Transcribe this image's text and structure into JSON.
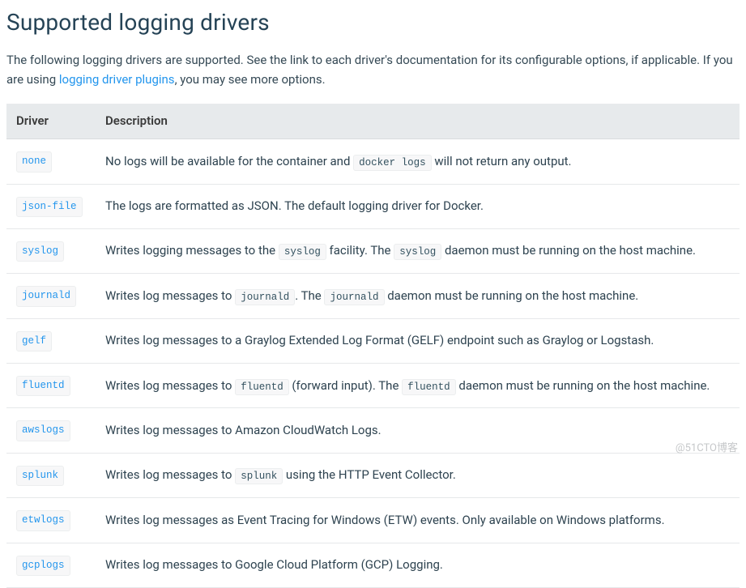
{
  "heading": "Supported logging drivers",
  "intro": {
    "part1": "The following logging drivers are supported. See the link to each driver's documentation for its configurable options, if applicable. If you are using ",
    "link": "logging driver plugins",
    "part2": ", you may see more options."
  },
  "table": {
    "headers": {
      "driver": "Driver",
      "description": "Description"
    },
    "rows": [
      {
        "driver": "none",
        "segments": [
          {
            "type": "text",
            "value": "No logs will be available for the container and "
          },
          {
            "type": "code",
            "value": "docker logs"
          },
          {
            "type": "text",
            "value": " will not return any output."
          }
        ]
      },
      {
        "driver": "json-file",
        "segments": [
          {
            "type": "text",
            "value": "The logs are formatted as JSON. The default logging driver for Docker."
          }
        ]
      },
      {
        "driver": "syslog",
        "segments": [
          {
            "type": "text",
            "value": "Writes logging messages to the "
          },
          {
            "type": "code",
            "value": "syslog"
          },
          {
            "type": "text",
            "value": " facility. The "
          },
          {
            "type": "code",
            "value": "syslog"
          },
          {
            "type": "text",
            "value": " daemon must be running on the host machine."
          }
        ]
      },
      {
        "driver": "journald",
        "segments": [
          {
            "type": "text",
            "value": "Writes log messages to "
          },
          {
            "type": "code",
            "value": "journald"
          },
          {
            "type": "text",
            "value": ". The "
          },
          {
            "type": "code",
            "value": "journald"
          },
          {
            "type": "text",
            "value": " daemon must be running on the host machine."
          }
        ]
      },
      {
        "driver": "gelf",
        "segments": [
          {
            "type": "text",
            "value": "Writes log messages to a Graylog Extended Log Format (GELF) endpoint such as Graylog or Logstash."
          }
        ]
      },
      {
        "driver": "fluentd",
        "segments": [
          {
            "type": "text",
            "value": "Writes log messages to "
          },
          {
            "type": "code",
            "value": "fluentd"
          },
          {
            "type": "text",
            "value": " (forward input). The "
          },
          {
            "type": "code",
            "value": "fluentd"
          },
          {
            "type": "text",
            "value": " daemon must be running on the host machine."
          }
        ]
      },
      {
        "driver": "awslogs",
        "segments": [
          {
            "type": "text",
            "value": "Writes log messages to Amazon CloudWatch Logs."
          }
        ]
      },
      {
        "driver": "splunk",
        "segments": [
          {
            "type": "text",
            "value": "Writes log messages to "
          },
          {
            "type": "code",
            "value": "splunk"
          },
          {
            "type": "text",
            "value": " using the HTTP Event Collector."
          }
        ]
      },
      {
        "driver": "etwlogs",
        "segments": [
          {
            "type": "text",
            "value": "Writes log messages as Event Tracing for Windows (ETW) events. Only available on Windows platforms."
          }
        ]
      },
      {
        "driver": "gcplogs",
        "segments": [
          {
            "type": "text",
            "value": "Writes log messages to Google Cloud Platform (GCP) Logging."
          }
        ]
      }
    ]
  },
  "watermark": "@51CTO博客"
}
